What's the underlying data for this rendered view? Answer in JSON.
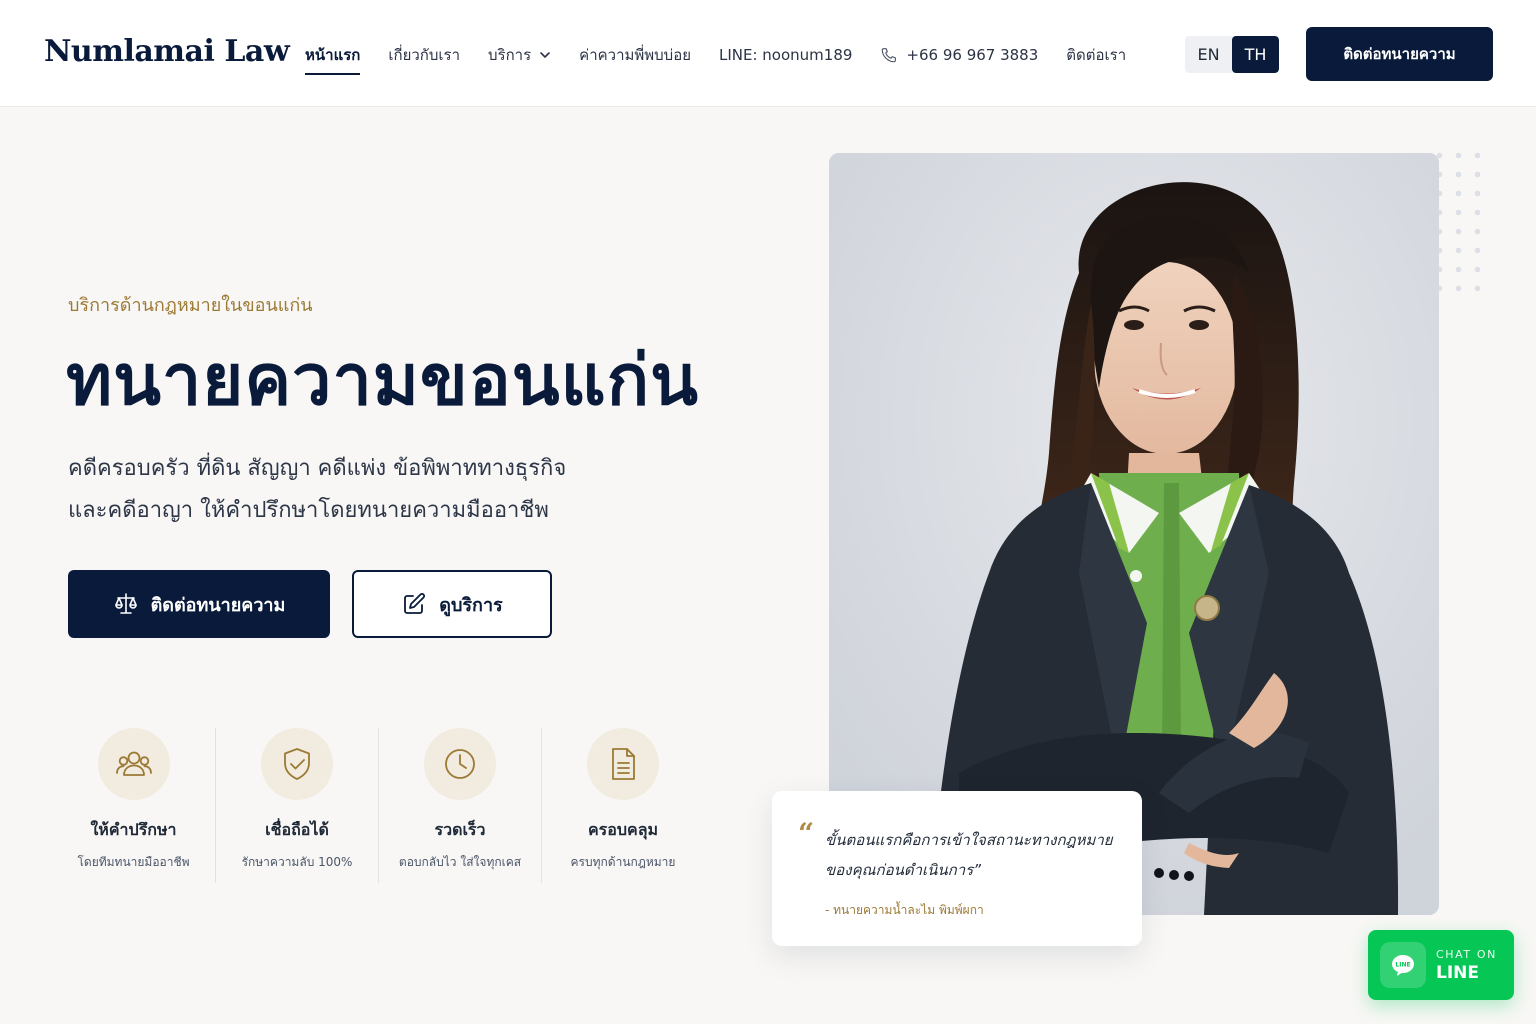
{
  "nav": {
    "brand": "Numlamai Law",
    "links": [
      {
        "label": "หน้าแรก"
      },
      {
        "label": "เกี่ยวกับเรา"
      },
      {
        "label": "บริการ"
      },
      {
        "label": "ค่าความพี่พบบ่อย"
      },
      {
        "label": "LINE: noonum189"
      },
      {
        "label": "+66 96 967 3883"
      },
      {
        "label": "ติดต่อเรา"
      }
    ],
    "lang_en": "EN",
    "lang_th": "TH",
    "cta": "ติดต่อทนายความ"
  },
  "hero": {
    "eyebrow": "บริการด้านกฎหมายในขอนแก่น",
    "title": "ทนายความขอนแก่น",
    "desc_line1": "คดีครอบครัว ที่ดิน สัญญา คดีแพ่ง ข้อพิพาททางธุรกิจ",
    "desc_line2": "และคดีอาญา ให้คำปรึกษาโดยทนายความมืออาชีพ",
    "btn_primary": "ติดต่อทนายความ",
    "btn_secondary": "ดูบริการ"
  },
  "features": [
    {
      "title": "ให้คำปรึกษา",
      "sub": "โดยทีมทนายมืออาชีพ",
      "icon": "users-icon"
    },
    {
      "title": "เชื่อถือได้",
      "sub": "รักษาความลับ 100%",
      "icon": "shield-check-icon"
    },
    {
      "title": "รวดเร็ว",
      "sub": "ตอบกลับไว ใส่ใจทุกเคส",
      "icon": "clock-icon"
    },
    {
      "title": "ครอบคลุม",
      "sub": "ครบทุกด้านกฎหมาย",
      "icon": "document-icon"
    }
  ],
  "quote": {
    "mark": "“",
    "text": "ขั้นตอนแรกคือการเข้าใจสถานะทางกฎหมายของคุณก่อนดำเนินการ”",
    "author": "- ทนายความน้ำละไม พิมพ์ผกา"
  },
  "chat": {
    "top": "CHAT ON",
    "bottom": "LINE"
  },
  "colors": {
    "navy": "#0a1a3a",
    "gold": "#9c7a35",
    "background": "#f8f7f5",
    "line_green": "#06c755"
  }
}
